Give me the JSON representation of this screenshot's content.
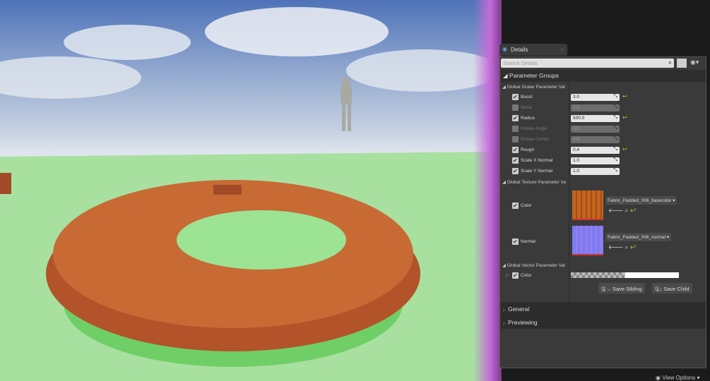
{
  "details": {
    "tab_label": "Details",
    "search_placeholder": "Search Details",
    "parameter_groups": "Parameter Groups",
    "scalar_section": "Global Scalar Parameter Val",
    "scalars": [
      {
        "label": "Boost",
        "value": "3.0",
        "enabled": true,
        "modified": true
      },
      {
        "label": "Metal",
        "value": "0.0",
        "enabled": false,
        "modified": false
      },
      {
        "label": "Radius",
        "value": "500.0",
        "enabled": true,
        "modified": true
      },
      {
        "label": "Rotate Angle",
        "value": "0.0",
        "enabled": false,
        "modified": false
      },
      {
        "label": "Rotate Center",
        "value": "0.0",
        "enabled": false,
        "modified": false
      },
      {
        "label": "Rough",
        "value": "0.4",
        "enabled": true,
        "modified": true
      },
      {
        "label": "Scale X Normal",
        "value": "1.0",
        "enabled": true,
        "modified": false
      },
      {
        "label": "Scale Y Normal",
        "value": "1.0",
        "enabled": true,
        "modified": false
      }
    ],
    "texture_section": "Global Texture Parameter Va",
    "textures": [
      {
        "label": "Color",
        "asset": "Fabric_Padded_006_basecolor"
      },
      {
        "label": "Normal",
        "asset": "Fabric_Padded_006_normal"
      }
    ],
    "vector_section": "Global Vector Parameter Val",
    "vector": {
      "label": "Color"
    },
    "save_sibling": "Save Sibling",
    "save_child": "Save Child",
    "categories": [
      "General",
      "Previewing"
    ],
    "view_options": "View Options"
  },
  "colors": {
    "accent_reset": "#c6c32a",
    "checker": "#ffffff"
  }
}
